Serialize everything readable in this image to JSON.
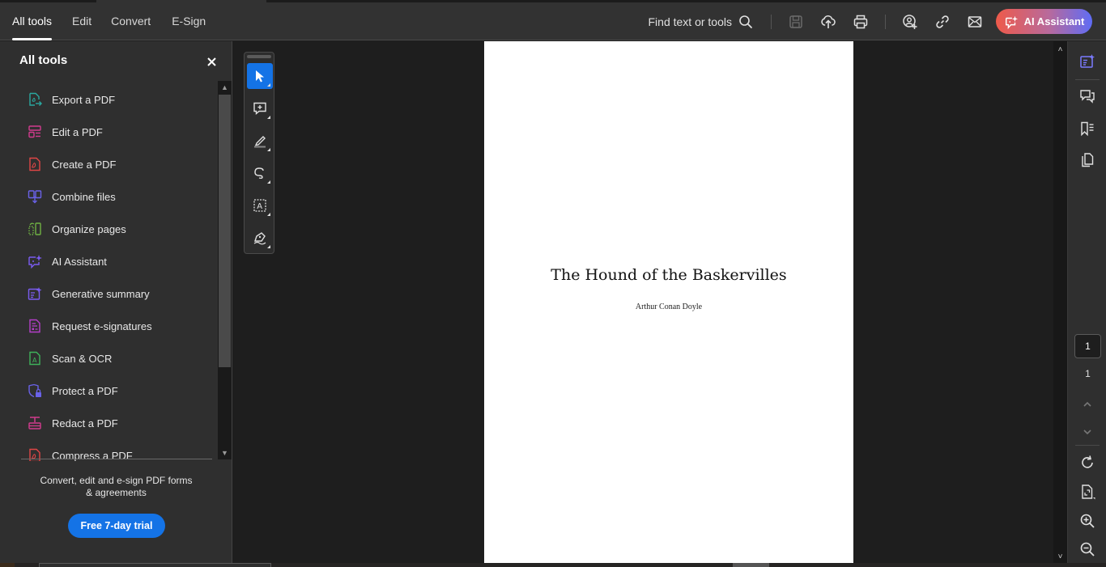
{
  "header": {
    "tabs": [
      {
        "label": "All tools",
        "active": true
      },
      {
        "label": "Edit",
        "active": false
      },
      {
        "label": "Convert",
        "active": false
      },
      {
        "label": "E-Sign",
        "active": false
      }
    ],
    "find_label": "Find text or tools",
    "icons": [
      "search-icon",
      "save-icon",
      "cloud-upload-icon",
      "print-icon",
      "share-user-icon",
      "link-icon",
      "email-icon"
    ],
    "ai_button_label": "AI Assistant"
  },
  "left_panel": {
    "title": "All tools",
    "tools": [
      {
        "label": "Export a PDF",
        "icon": "export-pdf-icon",
        "color": "#2aa8a0"
      },
      {
        "label": "Edit a PDF",
        "icon": "edit-pdf-icon",
        "color": "#d23b8e"
      },
      {
        "label": "Create a PDF",
        "icon": "create-pdf-icon",
        "color": "#e04646"
      },
      {
        "label": "Combine files",
        "icon": "combine-files-icon",
        "color": "#6a62e8"
      },
      {
        "label": "Organize pages",
        "icon": "organize-pages-icon",
        "color": "#6fb043"
      },
      {
        "label": "AI Assistant",
        "icon": "ai-assistant-icon",
        "color": "#7a5cf0"
      },
      {
        "label": "Generative summary",
        "icon": "generative-summary-icon",
        "color": "#7a5cf0"
      },
      {
        "label": "Request e-signatures",
        "icon": "request-esignatures-icon",
        "color": "#b53fc9"
      },
      {
        "label": "Scan & OCR",
        "icon": "scan-ocr-icon",
        "color": "#3fb25a"
      },
      {
        "label": "Protect a PDF",
        "icon": "protect-pdf-icon",
        "color": "#6a62e8"
      },
      {
        "label": "Redact a PDF",
        "icon": "redact-pdf-icon",
        "color": "#d23b8e"
      },
      {
        "label": "Compress a PDF",
        "icon": "compress-pdf-icon",
        "color": "#e04646"
      }
    ],
    "promo_text": "Convert, edit and e-sign PDF forms & agreements",
    "trial_button_label": "Free 7-day trial"
  },
  "doc_toolbar": {
    "tools": [
      {
        "name": "select-tool",
        "active": true
      },
      {
        "name": "add-comment-tool",
        "active": false
      },
      {
        "name": "highlight-tool",
        "active": false
      },
      {
        "name": "draw-tool",
        "active": false
      },
      {
        "name": "text-recognition-tool",
        "active": false
      },
      {
        "name": "sign-tool",
        "active": false
      }
    ]
  },
  "document": {
    "title": "The Hound of the Baskervilles",
    "author": "Arthur Conan Doyle"
  },
  "right_rail": {
    "current_page": "1",
    "total_pages": "1"
  },
  "colors": {
    "accent": "#1473e6",
    "ai_gradient_start": "#ee5a4a",
    "ai_gradient_end": "#5f6cf5"
  }
}
